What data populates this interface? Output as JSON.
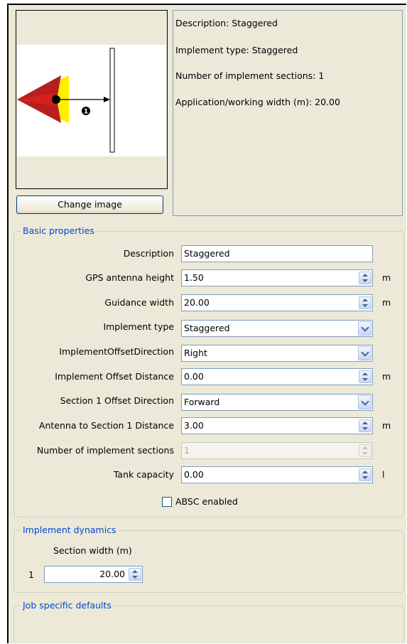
{
  "info": {
    "description": "Description: Staggered",
    "implement_type": "Implement type: Staggered",
    "sections": "Number of implement sections: 1",
    "width": "Application/working width (m): 20.00"
  },
  "image_section": {
    "change_image_label": "Change image",
    "section_marker": "1"
  },
  "basic": {
    "legend": "Basic properties",
    "fields": [
      {
        "label": "Description",
        "value": "Staggered",
        "unit": ""
      },
      {
        "label": "GPS antenna height",
        "value": "1.50",
        "unit": "m"
      },
      {
        "label": "Guidance width",
        "value": "20.00",
        "unit": "m"
      },
      {
        "label": "Implement type",
        "value": "Staggered",
        "unit": ""
      },
      {
        "label": "ImplementOffsetDirection",
        "value": "Right",
        "unit": ""
      },
      {
        "label": "Implement Offset Distance",
        "value": "0.00",
        "unit": "m"
      },
      {
        "label": "Section 1 Offset Direction",
        "value": "Forward",
        "unit": ""
      },
      {
        "label": "Antenna to Section 1 Distance",
        "value": "3.00",
        "unit": "m"
      },
      {
        "label": "Number of implement sections",
        "value": "1",
        "unit": ""
      },
      {
        "label": "Tank capacity",
        "value": "0.00",
        "unit": "l"
      }
    ],
    "absc_label": "ABSC enabled"
  },
  "dynamics": {
    "legend": "Implement dynamics",
    "column_header": "Section width (m)",
    "rows": [
      {
        "index": "1",
        "value": "20.00"
      }
    ]
  },
  "job": {
    "legend": "Job specific defaults"
  },
  "colors": {
    "legend": "#0046d5",
    "panel": "#ece9d8",
    "field_border": "#7f9db9",
    "implement_red": "#b81e1e",
    "implement_yellow": "#ffee00"
  }
}
